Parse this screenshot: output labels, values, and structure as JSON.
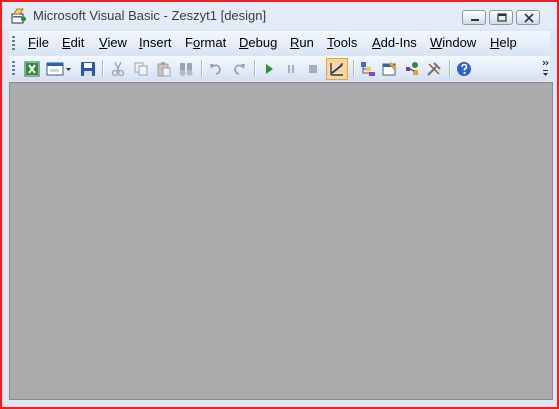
{
  "window": {
    "title": "Microsoft Visual Basic - Zeszyt1 [design]"
  },
  "menu": [
    {
      "label": "File",
      "mnemonic": "F",
      "rest": "ile"
    },
    {
      "label": "Edit",
      "mnemonic": "E",
      "rest": "dit"
    },
    {
      "label": "View",
      "mnemonic": "V",
      "rest": "iew"
    },
    {
      "label": "Insert",
      "mnemonic": "I",
      "rest": "nsert"
    },
    {
      "label": "Format",
      "mnemonic": "o",
      "pre": "F",
      "rest": "rmat"
    },
    {
      "label": "Debug",
      "mnemonic": "D",
      "rest": "ebug"
    },
    {
      "label": "Run",
      "mnemonic": "R",
      "rest": "un"
    },
    {
      "label": "Tools",
      "mnemonic": "T",
      "rest": "ools"
    },
    {
      "label": "Add-Ins",
      "mnemonic": "A",
      "rest": "dd-Ins"
    },
    {
      "label": "Window",
      "mnemonic": "W",
      "rest": "indow"
    },
    {
      "label": "Help",
      "mnemonic": "H",
      "rest": "elp"
    }
  ],
  "toolbar": {
    "icons": [
      "view-excel-icon",
      "insert-userform-icon",
      "save-icon",
      "cut-icon",
      "copy-icon",
      "paste-icon",
      "find-icon",
      "undo-icon",
      "redo-icon",
      "run-icon",
      "break-icon",
      "reset-icon",
      "design-mode-icon",
      "project-explorer-icon",
      "properties-window-icon",
      "object-browser-icon",
      "toolbox-icon",
      "help-icon"
    ]
  },
  "colors": {
    "frame": "#ff1a1a",
    "workspace": "#ababab",
    "chrome": "#dde6f3",
    "active_button": "#fdd89a"
  }
}
